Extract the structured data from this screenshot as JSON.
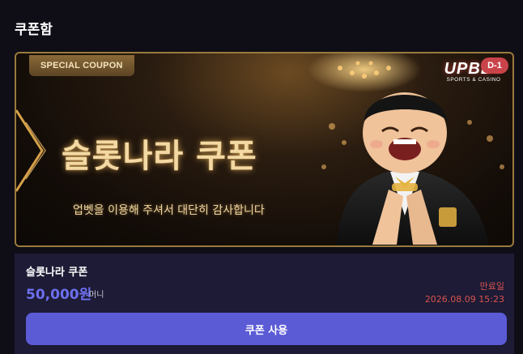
{
  "page": {
    "title": "쿠폰함"
  },
  "banner": {
    "tag": "SPECIAL COUPON",
    "brand_name": "UPBET",
    "brand_tagline": "SPORTS & CASINO",
    "dday": "D-1",
    "title": "슬롯나라 쿠폰",
    "subtitle": "업벳을 이용해 주셔서 대단히 감사합니다",
    "mascot_icon": "smiling-mascot-illustration",
    "accent_color": "#9a7a3c"
  },
  "coupon": {
    "name": "슬롯나라 쿠폰",
    "amount": "50,000원",
    "unit": "머니",
    "expiry_label": "만료일",
    "expiry_date": "2026.08.09 15:23",
    "amount_color": "#6d6ff0",
    "expiry_color": "#d9534f"
  },
  "actions": {
    "use_label": "쿠폰 사용",
    "button_color": "#5b5bd6"
  }
}
